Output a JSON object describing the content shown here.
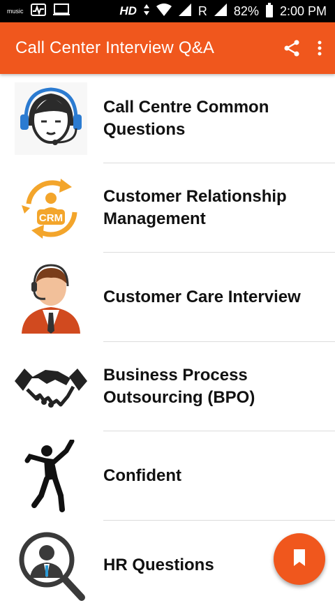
{
  "status_bar": {
    "left_icons": [
      "music-icon",
      "activity-icon",
      "screen-icon"
    ],
    "music_label": "music",
    "hd": "HD",
    "roaming": "R",
    "battery": "82%",
    "time": "2:00 PM"
  },
  "app_bar": {
    "title": "Call Center Interview Q&A",
    "actions": [
      "share-icon",
      "more-vert-icon"
    ]
  },
  "list": {
    "items": [
      {
        "label_line1": "Call Centre Common",
        "label_line2": "Questions",
        "icon": "headset-agent-icon"
      },
      {
        "label_line1": "Customer Relationship",
        "label_line2": "Management",
        "icon": "crm-cycle-icon",
        "icon_text": "CRM"
      },
      {
        "label_line1": "Customer Care Interview",
        "label_line2": "",
        "icon": "call-agent-icon"
      },
      {
        "label_line1": "Business Process",
        "label_line2": "Outsourcing (BPO)",
        "icon": "handshake-icon"
      },
      {
        "label_line1": "Confident",
        "label_line2": "",
        "icon": "jumping-person-icon"
      },
      {
        "label_line1": "HR Questions",
        "label_line2": "",
        "icon": "magnifier-person-icon"
      }
    ]
  },
  "fab": {
    "icon": "bookmark-icon"
  },
  "colors": {
    "accent": "#f0571d",
    "status_bar": "#000000",
    "text": "#111111",
    "divider": "#dcdcdc"
  }
}
